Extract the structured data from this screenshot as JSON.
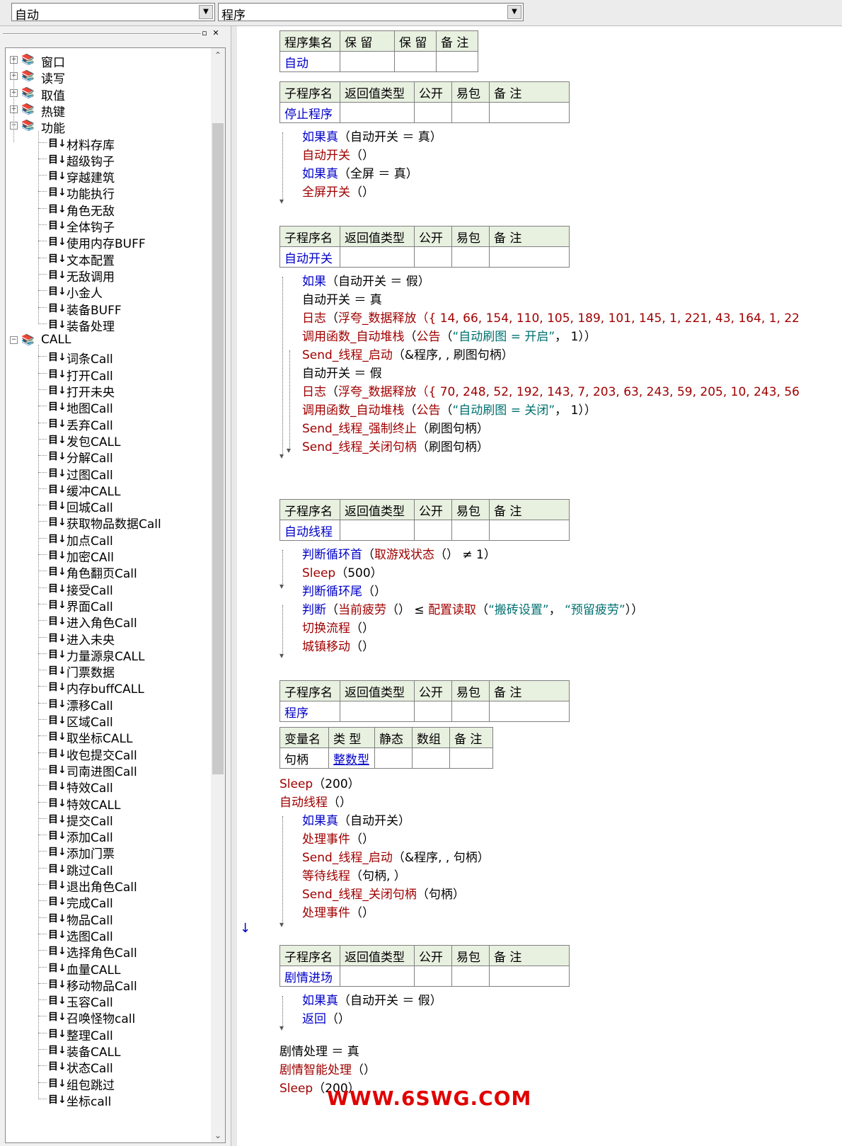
{
  "top": {
    "combo_left": "自动",
    "combo_right": "程序"
  },
  "tree": {
    "groups": [
      {
        "label": "窗口",
        "expanded": false
      },
      {
        "label": "读写",
        "expanded": false
      },
      {
        "label": "取值",
        "expanded": false
      },
      {
        "label": "热键",
        "expanded": false
      },
      {
        "label": "功能",
        "expanded": true
      },
      {
        "label": "CALL",
        "expanded": true
      }
    ],
    "func_items": [
      "材料存库",
      "超级钩子",
      "穿越建筑",
      "功能执行",
      "角色无敌",
      "全体钩子",
      "使用内存BUFF",
      "文本配置",
      "无敌调用",
      "小金人",
      "装备BUFF",
      "装备处理"
    ],
    "call_items": [
      "词条Call",
      "打开Call",
      "打开未央",
      "地图Call",
      "丢弃Call",
      "发包CALL",
      "分解Call",
      "过图Call",
      "缓冲CALL",
      "回城Call",
      "获取物品数据Call",
      "加点Call",
      "加密CAll",
      "角色翻页Call",
      "接受Call",
      "界面Call",
      "进入角色Call",
      "进入未央",
      "力量源泉CALL",
      "门票数据",
      "内存buffCALL",
      "漂移Call",
      "区域Call",
      "取坐标CALL",
      "收包提交Call",
      "司南进图Call",
      "特效Call",
      "特效CALL",
      "提交Call",
      "添加Call",
      "添加门票",
      "跳过Call",
      "退出角色Call",
      "完成Call",
      "物品Call",
      "选图Call",
      "选择角色Call",
      "血量CALL",
      "移动物品Call",
      "玉容Call",
      "召唤怪物call",
      "整理Call",
      "装备CALL",
      "状态Call",
      "组包跳过",
      "坐标call"
    ]
  },
  "code": {
    "assembly_header": [
      "程序集名",
      "保 留",
      "保 留",
      "备 注"
    ],
    "assembly_name": "自动",
    "sub_header": [
      "子程序名",
      "返回值类型",
      "公开",
      "易包",
      "备 注"
    ],
    "var_header": [
      "变量名",
      "类 型",
      "静态",
      "数组",
      "备 注"
    ],
    "sub1": {
      "name": "停止程序",
      "lines": [
        [
          [
            "blue",
            "如果真"
          ],
          [
            "blk",
            "（自动开关 ＝ 真）"
          ]
        ],
        [
          [
            "red",
            "自动开关"
          ],
          [
            "blk",
            "（）"
          ]
        ],
        [
          [
            "blue",
            "如果真"
          ],
          [
            "blk",
            "（全屏 ＝ 真）"
          ]
        ],
        [
          [
            "red",
            "全屏开关"
          ],
          [
            "blk",
            "（）"
          ]
        ]
      ]
    },
    "sub2": {
      "name": "自动开关",
      "lines": [
        [
          [
            "blue",
            "如果"
          ],
          [
            "blk",
            "（自动开关 ＝ 假）"
          ]
        ],
        [
          [
            "blk",
            "自动开关 ＝ 真"
          ]
        ],
        [
          [
            "red",
            "日志"
          ],
          [
            "blk",
            "（"
          ],
          [
            "red",
            "浮夸_数据释放（{ 14, 66, 154, 110, 105, 189, 101, 145, 1, 221, 43, 164, 1, 22"
          ]
        ],
        [
          [
            "red",
            "调用函数_自动堆栈"
          ],
          [
            "blk",
            "（"
          ],
          [
            "red",
            "公告"
          ],
          [
            "blk",
            "（"
          ],
          [
            "teal",
            "“自动刷图 = 开启”"
          ],
          [
            "blk",
            "， 1））"
          ]
        ],
        [
          [
            "red",
            "Send_线程_启动"
          ],
          [
            "blk",
            "（&程序, , 刷图句柄）"
          ]
        ],
        [
          [
            "blk",
            "自动开关 ＝ 假"
          ]
        ],
        [
          [
            "red",
            "日志"
          ],
          [
            "blk",
            "（"
          ],
          [
            "red",
            "浮夸_数据释放（{ 70, 248, 52, 192, 143, 7, 203, 63, 243, 59, 205, 10, 243, 56"
          ]
        ],
        [
          [
            "red",
            "调用函数_自动堆栈"
          ],
          [
            "blk",
            "（"
          ],
          [
            "red",
            "公告"
          ],
          [
            "blk",
            "（"
          ],
          [
            "teal",
            "“自动刷图 = 关闭”"
          ],
          [
            "blk",
            "， 1））"
          ]
        ],
        [
          [
            "red",
            "Send_线程_强制终止"
          ],
          [
            "blk",
            "（刷图句柄）"
          ]
        ],
        [
          [
            "red",
            "Send_线程_关闭句柄"
          ],
          [
            "blk",
            "（刷图句柄）"
          ]
        ]
      ]
    },
    "sub3": {
      "name": "自动线程",
      "lines": [
        [
          [
            "blue",
            "判断循环首"
          ],
          [
            "blk",
            "（"
          ],
          [
            "red",
            "取游戏状态"
          ],
          [
            "blk",
            "（） ≠ 1）"
          ]
        ],
        [
          [
            "red",
            "Sleep"
          ],
          [
            "blk",
            "（500）"
          ]
        ],
        [
          [
            "blue",
            "判断循环尾"
          ],
          [
            "blk",
            "（）"
          ]
        ],
        [
          [
            "blue",
            "判断"
          ],
          [
            "blk",
            "（"
          ],
          [
            "red",
            "当前疲劳"
          ],
          [
            "blk",
            "（） ≤ "
          ],
          [
            "red",
            "配置读取"
          ],
          [
            "blk",
            "（"
          ],
          [
            "teal",
            "“搬砖设置”"
          ],
          [
            "blk",
            "， "
          ],
          [
            "teal",
            "“预留疲劳”"
          ],
          [
            "blk",
            "））"
          ]
        ],
        [
          [
            "red",
            "切换流程"
          ],
          [
            "blk",
            "（）"
          ]
        ],
        [
          [
            "red",
            "城镇移动"
          ],
          [
            "blk",
            "（）"
          ]
        ]
      ]
    },
    "sub4": {
      "name": "程序",
      "var_name": "句柄",
      "var_type": "整数型",
      "lines": [
        [
          [
            "red",
            "Sleep"
          ],
          [
            "blk",
            "（200）"
          ]
        ],
        [
          [
            "red",
            "自动线程"
          ],
          [
            "blk",
            "（）"
          ]
        ],
        [
          [
            "blue",
            "如果真"
          ],
          [
            "blk",
            "（自动开关）"
          ]
        ],
        [
          [
            "red",
            "处理事件"
          ],
          [
            "blk",
            "（）"
          ]
        ],
        [
          [
            "red",
            "Send_线程_启动"
          ],
          [
            "blk",
            "（&程序, , 句柄）"
          ]
        ],
        [
          [
            "red",
            "等待线程"
          ],
          [
            "blk",
            "（句柄, ）"
          ]
        ],
        [
          [
            "red",
            "Send_线程_关闭句柄"
          ],
          [
            "blk",
            "（句柄）"
          ]
        ],
        [
          [
            "red",
            "处理事件"
          ],
          [
            "blk",
            "（）"
          ]
        ]
      ]
    },
    "sub5": {
      "name": "剧情进场",
      "lines": [
        [
          [
            "blue",
            "如果真"
          ],
          [
            "blk",
            "（自动开关 ＝ 假）"
          ]
        ],
        [
          [
            "blue",
            "返回"
          ],
          [
            "blk",
            "（）"
          ]
        ],
        [
          [
            "blk",
            "剧情处理 ＝ 真"
          ]
        ],
        [
          [
            "red",
            "剧情智能处理"
          ],
          [
            "blk",
            "（）"
          ]
        ],
        [
          [
            "red",
            "Sleep"
          ],
          [
            "blk",
            "（200）"
          ]
        ]
      ]
    }
  },
  "watermark": "WWW.6SWG.COM"
}
